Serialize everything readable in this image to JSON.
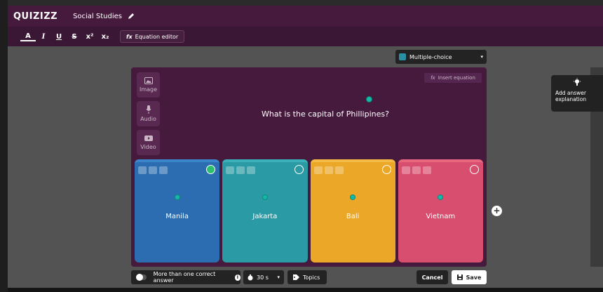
{
  "header": {
    "logo": "QUIZIZZ",
    "quiz_title": "Social Studies"
  },
  "toolbar": {
    "bold": "A",
    "italic": "I",
    "underline": "U",
    "strike": "S",
    "superscript": "x²",
    "subscript": "x₂",
    "equation_label": "Equation editor"
  },
  "question_type": {
    "selected": "Multiple-choice"
  },
  "editor": {
    "insert_equation": "Insert equation",
    "media": [
      {
        "label": "Image",
        "icon": "image-icon"
      },
      {
        "label": "Audio",
        "icon": "microphone-icon"
      },
      {
        "label": "Video",
        "icon": "video-icon"
      }
    ],
    "question": "What is the capital of Phillipines?"
  },
  "options": [
    {
      "text": "Manila",
      "color": "#2b6db0",
      "correct": true
    },
    {
      "text": "Jakarta",
      "color": "#2a9ba4",
      "correct": false
    },
    {
      "text": "Bali",
      "color": "#eba728",
      "correct": false
    },
    {
      "text": "Vietnam",
      "color": "#d84e6f",
      "correct": false
    }
  ],
  "explanation": {
    "label": "Add answer explanation"
  },
  "footer": {
    "multi_correct_label": "More than one correct answer",
    "time": "30 s",
    "topics": "Topics",
    "cancel": "Cancel",
    "save": "Save"
  },
  "colors": {
    "purple_dark": "#461a3d",
    "accent_teal": "#14b8a6"
  }
}
